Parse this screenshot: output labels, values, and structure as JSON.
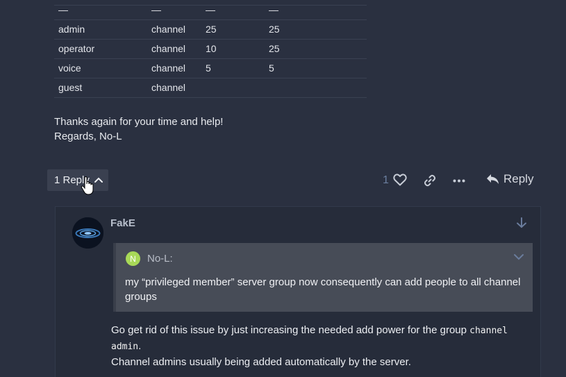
{
  "table": {
    "rows": [
      [
        "—",
        "—",
        "—",
        "—"
      ],
      [
        "admin",
        "channel",
        "25",
        "25"
      ],
      [
        "operator",
        "channel",
        "10",
        "25"
      ],
      [
        "voice",
        "channel",
        "5",
        "5"
      ],
      [
        "guest",
        "channel",
        "",
        ""
      ]
    ]
  },
  "post": {
    "thanks_line": "Thanks again for your time and help!",
    "regards_line": "Regards, No-L"
  },
  "controls": {
    "replies_label": "1 Reply",
    "like_count": "1",
    "reply_label": "Reply",
    "icons": [
      "heart-icon",
      "link-icon",
      "more-icon",
      "reply-arrow-icon"
    ]
  },
  "reply": {
    "author": "FakE",
    "quote": {
      "avatar_letter": "N",
      "author": "No-L:",
      "text": "my “privileged member” server group now consequently can add people to all channel groups"
    },
    "text_before": "Go get rid of this issue by just increasing the needed add power for the group ",
    "code": "channel admin",
    "text_after": ".",
    "line2": "Channel admins usually being added automatically by the server."
  },
  "colors": {
    "background": "#2a3040",
    "quote_bg": "#474c57",
    "avatar_green": "#a8d958",
    "muted_blue": "#6c7fa0"
  }
}
